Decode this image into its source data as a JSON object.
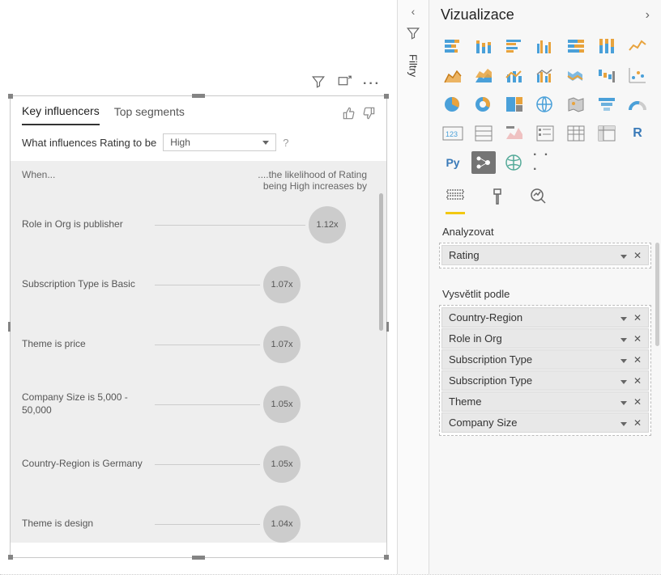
{
  "canvas": {
    "toolbar": {
      "filter": "filter",
      "focus": "focus",
      "more": "more"
    },
    "tabs": {
      "key_influencers": "Key influencers",
      "top_segments": "Top segments"
    },
    "question_prefix": "What influences Rating to be",
    "dropdown_value": "High",
    "question_suffix": "?",
    "headers": {
      "when": "When...",
      "result": "....the likelihood of Rating being High increases by"
    },
    "influencers": [
      {
        "label": "Role in Org is publisher",
        "value": "1.12x"
      },
      {
        "label": "Subscription Type is Basic",
        "value": "1.07x"
      },
      {
        "label": "Theme is price",
        "value": "1.07x"
      },
      {
        "label": "Company Size is 5,000 - 50,000",
        "value": "1.05x"
      },
      {
        "label": "Country-Region is Germany",
        "value": "1.05x"
      },
      {
        "label": "Theme is design",
        "value": "1.04x"
      }
    ]
  },
  "filters_pane": {
    "label": "Filtry"
  },
  "viz_pane": {
    "title": "Vizualizace",
    "r_label": "R",
    "py_label": "Py",
    "more": "· · ·",
    "section_analyze": "Analyzovat",
    "analyze_fields": [
      "Rating"
    ],
    "section_explain": "Vysvětlit podle",
    "explain_fields": [
      "Country-Region",
      "Role in Org",
      "Subscription Type",
      "Subscription Type",
      "Theme",
      "Company Size"
    ]
  }
}
